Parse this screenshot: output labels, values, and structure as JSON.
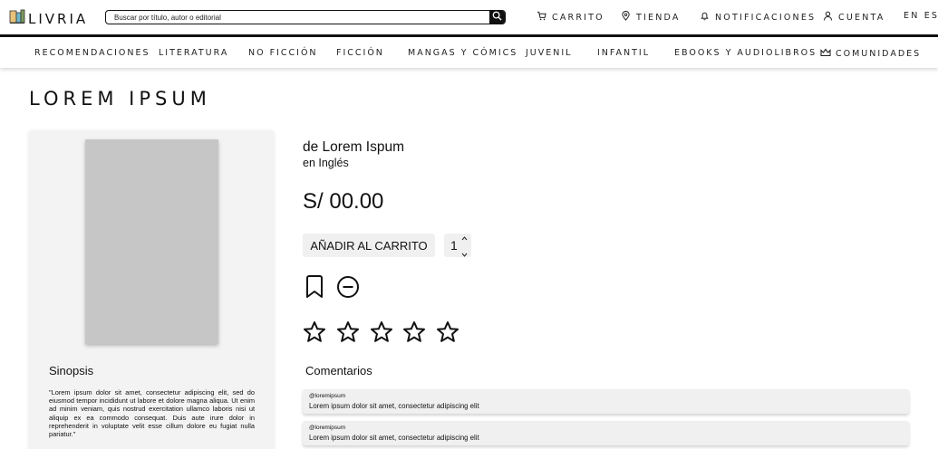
{
  "header": {
    "logo_text": "LIVRIA",
    "search_placeholder": "Buscar por título, autor o editorial",
    "links": {
      "cart": "CARRITO",
      "store": "TIENDA",
      "notifications": "NOTIFICACIONES",
      "account": "CUENTA",
      "language": "EN ES"
    }
  },
  "nav": {
    "items": [
      "RECOMENDACIONES",
      "LITERATURA",
      "NO FICCIÓN",
      "FICCIÓN",
      "MANGAS Y CÓMICS",
      "JUVENIL",
      "INFANTIL",
      "EBOOKS Y AUDIOLIBROS",
      "COMUNIDADES"
    ]
  },
  "page": {
    "title": "LOREM IPSUM"
  },
  "book": {
    "synopsis_title": "Sinopsis",
    "synopsis_text": "\"Lorem ipsum dolor sit amet, consectetur adipiscing elit, sed do eiusmod tempor incididunt ut labore et dolore magna aliqua. Ut enim ad minim veniam, quis nostrud exercitation ullamco laboris nisi ut aliquip ex ea commodo consequat. Duis aute irure dolor in reprehenderit in voluptate velit esse cillum dolore eu fugiat nulla pariatur.\"",
    "author": "de Lorem Ispum",
    "language": "en Inglés",
    "price": "S/ 00.00",
    "add_to_cart": "AÑADIR AL CARRITO",
    "quantity": "1",
    "rating": 0,
    "rating_max": 5
  },
  "comments": {
    "title": "Comentarios",
    "items": [
      {
        "user": "@loremipsum",
        "text": "Lorem ipsum dolor sit amet, consectetur adipiscing elit"
      },
      {
        "user": "@loremipsum",
        "text": "Lorem ipsum dolor sit amet, consectetur adipiscing elit"
      }
    ]
  },
  "icons": {
    "logo": "book-stack-icon",
    "search": "search-icon",
    "cart": "cart-icon",
    "store": "location-pin-icon",
    "notifications": "bell-icon",
    "account": "user-icon",
    "communities": "crown-icon",
    "bookmark": "bookmark-icon",
    "remove": "minus-circle-icon",
    "star": "star-outline-icon"
  }
}
